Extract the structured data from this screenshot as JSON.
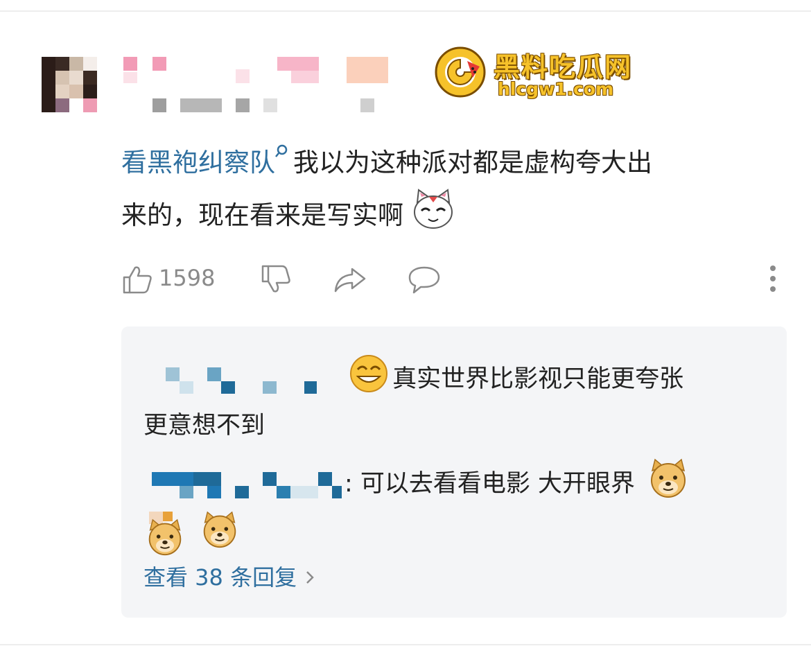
{
  "watermark": {
    "title": "黑料吃瓜网",
    "url": "hlcgw1.com"
  },
  "comment": {
    "topic": "看黑袍纠察队",
    "text_line1": "我以为这种派对都是虚构夸大出",
    "text_line2": "来的，现在看来是写实啊",
    "emoji": "cat-face-emoji"
  },
  "actions": {
    "like_count": "1598",
    "icons": [
      "thumbs-up-icon",
      "thumbs-down-icon",
      "share-icon",
      "reply-icon",
      "more-icon"
    ]
  },
  "replies": {
    "reply1_text": "真实世界比影视只能更夸张",
    "reply1_text2": "更意想不到",
    "reply2_text": ": 可以去看看电影  大开眼界",
    "view_more": "查看 38 条回复"
  },
  "colors": {
    "link": "#2f6f9f",
    "reply_bg": "#f4f5f7",
    "watermark_gold": "#f6c22a"
  }
}
